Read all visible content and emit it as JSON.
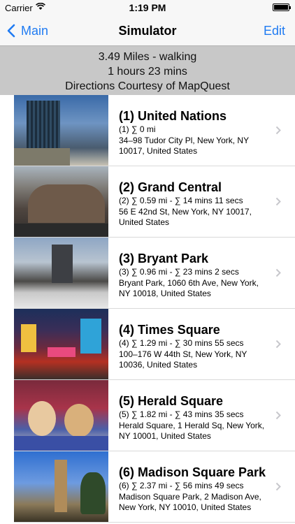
{
  "status_bar": {
    "carrier": "Carrier",
    "time": "1:19 PM"
  },
  "nav": {
    "back_label": "Main",
    "title": "Simulator",
    "edit_label": "Edit"
  },
  "summary": {
    "distance": "3.49 Miles - walking",
    "duration": "1 hours 23 mins",
    "credit": "Directions Courtesy of MapQuest"
  },
  "accent_color": "#1f7bf2",
  "stops": [
    {
      "title": "(1) United Nations",
      "stats": "(1) ∑ 0 mi",
      "address": "34–98 Tudor City Pl, New York, NY  10017, United States"
    },
    {
      "title": "(2) Grand Central",
      "stats": "(2) ∑ 0.59 mi  - ∑ 14 mins 11 secs",
      "address": "56 E 42nd St, New York, NY  10017, United States"
    },
    {
      "title": "(3) Bryant Park",
      "stats": "(3) ∑ 0.96 mi  - ∑ 23 mins 2 secs",
      "address": "Bryant Park, 1060 6th Ave, New York, NY  10018, United States"
    },
    {
      "title": "(4) Times Square",
      "stats": "(4) ∑ 1.29 mi  - ∑ 30 mins 55 secs",
      "address": "100–176 W 44th St, New York, NY  10036, United States"
    },
    {
      "title": "(5) Herald Square",
      "stats": "(5) ∑ 1.82 mi  - ∑ 43 mins 35 secs",
      "address": "Herald Square, 1 Herald Sq, New York, NY  10001, United States"
    },
    {
      "title": "(6) Madison Square Park",
      "stats": "(6) ∑ 2.37 mi  - ∑ 56 mins 49 secs",
      "address": "Madison Square Park, 2 Madison Ave, New York, NY  10010, United States"
    }
  ]
}
